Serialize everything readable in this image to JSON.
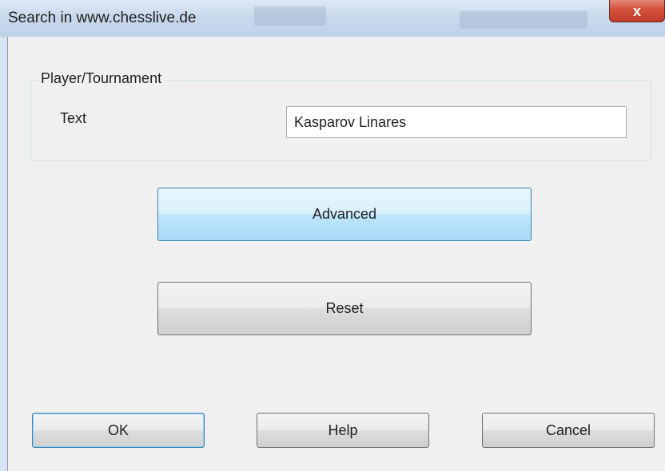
{
  "window": {
    "title": "Search in www.chesslive.de",
    "close_glyph": "x"
  },
  "group": {
    "legend": "Player/Tournament",
    "text_label": "Text",
    "text_value": "Kasparov Linares"
  },
  "buttons": {
    "advanced": "Advanced",
    "reset": "Reset",
    "ok": "OK",
    "help": "Help",
    "cancel": "Cancel"
  },
  "colors": {
    "title_bar": "#c9d9ec",
    "dialog_bg": "#f0f0f0",
    "close_button": "#c0392b",
    "hot_button": "#bee6fd"
  }
}
